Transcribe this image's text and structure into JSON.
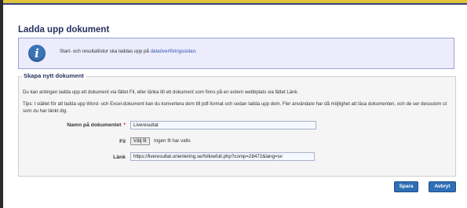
{
  "page": {
    "title": "Ladda upp dokument",
    "colors": {
      "accent": "#2f6fb5",
      "title": "#27315f",
      "info_bg": "#ececfd",
      "required": "#d42020"
    }
  },
  "info": {
    "icon": "info-icon",
    "text": "Start- och resultatlistor ska laddas upp på ",
    "link": "dataöverföringssidan",
    "suffix": "."
  },
  "section": {
    "legend": "Skapa nytt dokument",
    "description": "Du kan antingen ladda upp ett dokument via fältet Fil, eller länka till ett dokument som finns på en extern webbplats via fältet Länk.",
    "tips": "Tips: I stället för att ladda upp Word- och Excel-dokument kan du konvertera dem till pdf-format och sedan ladda upp dem. Fler användare har då möjlighet att läsa dokumenten, och de ser dessutom ut som du har tänkt dig."
  },
  "form": {
    "name_label": "Namn på dokumentet",
    "required_mark": "*",
    "name_value": "Liveresultat",
    "file_label": "Fil",
    "file_button": "Välj fil",
    "file_status": "Ingen fil har valts",
    "link_label": "Länk",
    "link_value": "https://liveresultat.orientering.se/followfull.php?comp=28472&lang=sv"
  },
  "actions": {
    "save": "Spara",
    "cancel": "Avbryt"
  }
}
